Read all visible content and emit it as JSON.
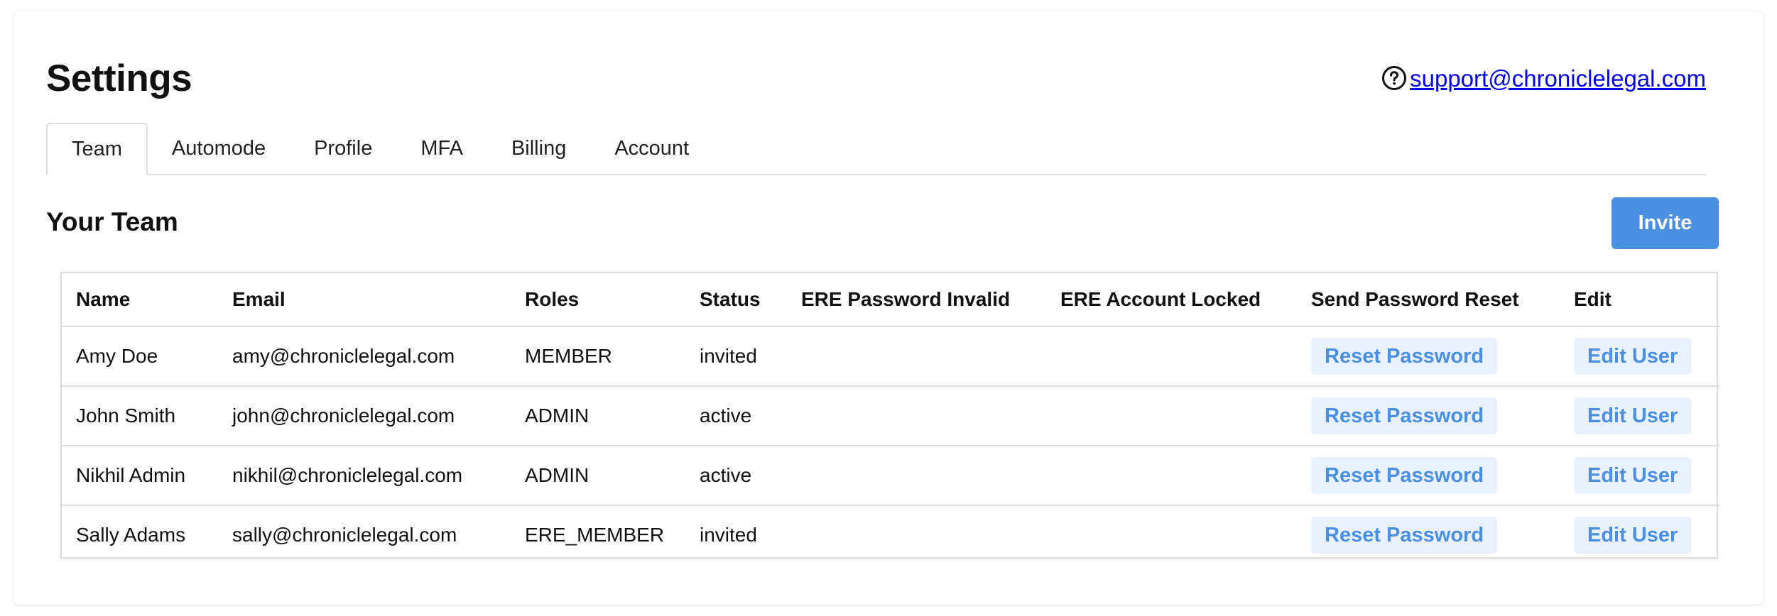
{
  "header": {
    "title": "Settings",
    "support_email": "support@chroniclelegal.com",
    "help_icon": "question-circle-icon"
  },
  "tabs": [
    {
      "label": "Team",
      "active": true
    },
    {
      "label": "Automode",
      "active": false
    },
    {
      "label": "Profile",
      "active": false
    },
    {
      "label": "MFA",
      "active": false
    },
    {
      "label": "Billing",
      "active": false
    },
    {
      "label": "Account",
      "active": false
    }
  ],
  "team": {
    "title": "Your Team",
    "invite_label": "Invite",
    "columns": [
      "Name",
      "Email",
      "Roles",
      "Status",
      "ERE Password Invalid",
      "ERE Account Locked",
      "Send Password Reset",
      "Edit"
    ],
    "rows": [
      {
        "name": "Amy Doe",
        "email": "amy@chroniclelegal.com",
        "role": "MEMBER",
        "status": "invited",
        "ere_password_invalid": "",
        "ere_account_locked": "",
        "reset_label": "Reset Password",
        "edit_label": "Edit User"
      },
      {
        "name": "John Smith",
        "email": "john@chroniclelegal.com",
        "role": "ADMIN",
        "status": "active",
        "ere_password_invalid": "",
        "ere_account_locked": "",
        "reset_label": "Reset Password",
        "edit_label": "Edit User"
      },
      {
        "name": "Nikhil Admin",
        "email": "nikhil@chroniclelegal.com",
        "role": "ADMIN",
        "status": "active",
        "ere_password_invalid": "",
        "ere_account_locked": "",
        "reset_label": "Reset Password",
        "edit_label": "Edit User"
      },
      {
        "name": "Sally Adams",
        "email": "sally@chroniclelegal.com",
        "role": "ERE_MEMBER",
        "status": "invited",
        "ere_password_invalid": "",
        "ere_account_locked": "",
        "reset_label": "Reset Password",
        "edit_label": "Edit User"
      }
    ]
  },
  "colors": {
    "accent": "#4a8fe2",
    "accent_light": "#e8f1fc",
    "link": "#0000ee",
    "border": "#dcdcdc"
  }
}
